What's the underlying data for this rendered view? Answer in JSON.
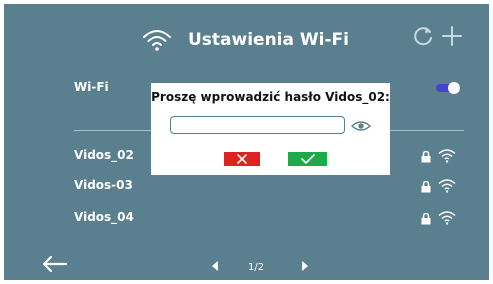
{
  "header": {
    "title": "Ustawienia Wi-Fi"
  },
  "wifi_row": {
    "label": "Wi-Fi",
    "enabled": true
  },
  "networks": [
    {
      "name": "Vidos_02",
      "secured": true
    },
    {
      "name": "Vidos-03",
      "secured": true
    },
    {
      "name": "Vidos_04",
      "secured": true
    }
  ],
  "pagination": {
    "label": "1/2"
  },
  "dialog": {
    "prompt": "Proszę wprowadzić hasło Vidos_02:",
    "password_value": ""
  },
  "colors": {
    "background": "#5a7f8f",
    "toggle": "#4444cc",
    "cancel": "#dd2222",
    "confirm": "#1faa4a"
  },
  "icons": {
    "title": "wifi-icon",
    "refresh": "refresh-icon",
    "add": "plus-icon",
    "lock": "lock-icon",
    "signal": "wifi-signal-icon",
    "back": "arrow-left-icon",
    "prev": "triangle-left-icon",
    "next": "triangle-right-icon",
    "reveal": "eye-icon",
    "cancel": "x-icon",
    "confirm": "check-icon"
  }
}
